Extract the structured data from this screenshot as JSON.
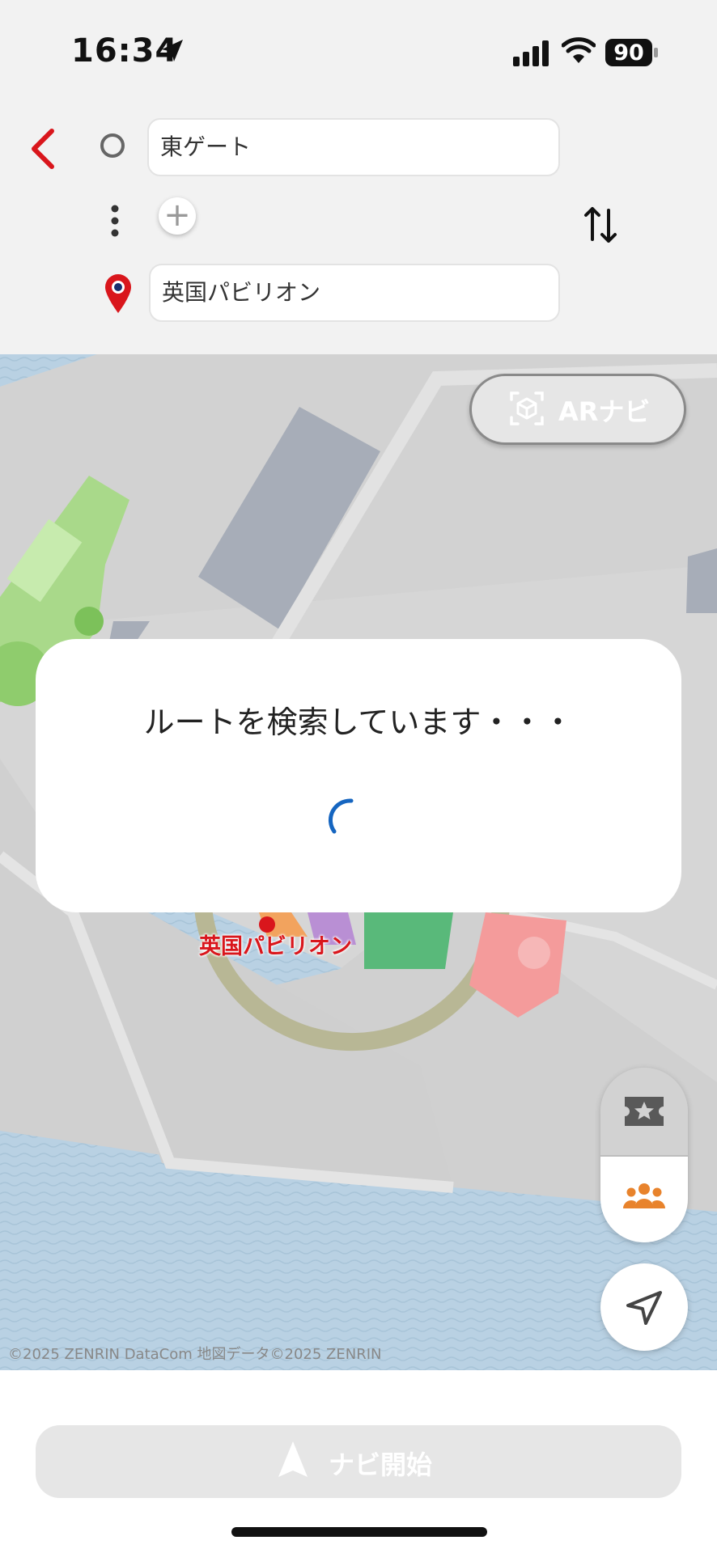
{
  "status_bar": {
    "time": "16:34",
    "battery": "90"
  },
  "route": {
    "origin_value": "東ゲート",
    "destination_value": "英国パビリオン"
  },
  "map": {
    "ar_button_label": "ARナビ",
    "destination_label": "英国パビリオン",
    "attribution": "©2025 ZENRIN DataCom 地図データ©2025 ZENRIN"
  },
  "dialog": {
    "message": "ルートを検索しています・・・"
  },
  "bottom": {
    "navi_button_label": "ナビ開始"
  },
  "icons": {
    "back": "chevron-left-icon",
    "origin": "circle-icon",
    "more": "vertical-dots-icon",
    "add": "plus-icon",
    "swap": "swap-vertical-icon",
    "destination": "map-pin-icon",
    "ar": "ar-cube-icon",
    "favorites": "ticket-star-icon",
    "crowd": "people-icon",
    "locate": "navigation-arrow-icon",
    "navi": "navigation-arrow-icon"
  },
  "colors": {
    "accent_red": "#d9161c",
    "crowd_orange": "#e8832c",
    "spinner_blue": "#1565c0"
  }
}
